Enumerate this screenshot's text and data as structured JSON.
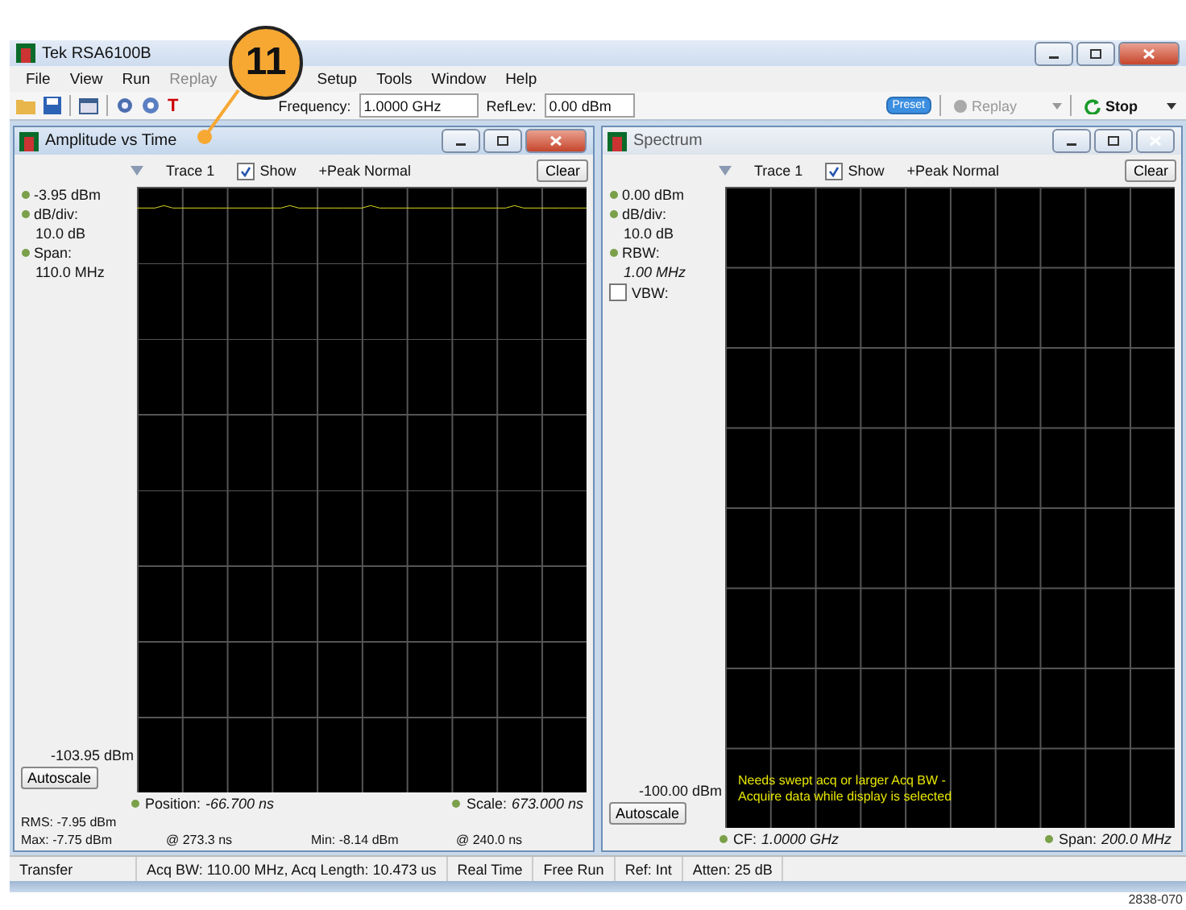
{
  "window": {
    "title": "Tek RSA6100B"
  },
  "callout": {
    "label": "11"
  },
  "menu": [
    {
      "label": "File",
      "disabled": false
    },
    {
      "label": "View",
      "disabled": false
    },
    {
      "label": "Run",
      "disabled": false
    },
    {
      "label": "Replay",
      "disabled": true
    },
    {
      "label": "Setup",
      "disabled": false
    },
    {
      "label": "Tools",
      "disabled": false
    },
    {
      "label": "Window",
      "disabled": false
    },
    {
      "label": "Help",
      "disabled": false
    }
  ],
  "toolbar": {
    "glyph": "T",
    "frequency": {
      "label": "Frequency:",
      "value": "1.0000 GHz"
    },
    "reflev": {
      "label": "RefLev:",
      "value": "0.00 dBm"
    },
    "preset": "Preset",
    "replay": {
      "label": "Replay",
      "disabled": true
    },
    "stop": "Stop"
  },
  "panes": [
    {
      "kind": "time",
      "title": "Amplitude vs Time",
      "active": true,
      "trace": "Trace 1",
      "show": {
        "label": "Show",
        "checked": true
      },
      "detection": "+Peak Normal",
      "clear": "Clear",
      "top": "-3.95 dBm",
      "params": [
        {
          "kind": "fixed",
          "label": "dB/div:",
          "value": "10.0 dB"
        },
        {
          "kind": "fixed",
          "label": "Span:",
          "value": "110.0 MHz"
        }
      ],
      "bottom": "-103.95 dBm",
      "autoscale": "Autoscale",
      "footer": [
        {
          "label": "Position:",
          "value": "-66.700 ns"
        },
        {
          "label": "Scale:",
          "value": "673.000 ns"
        }
      ],
      "stats": [
        {
          "label": "RMS:",
          "value": "-7.95 dBm"
        },
        {
          "label": "Max:",
          "value": "-7.75 dBm"
        },
        {
          "label": "@",
          "value": "273.3 ns"
        },
        {
          "label": "Min:",
          "value": "-8.14 dBm"
        },
        {
          "label": "@",
          "value": "240.0 ns"
        }
      ]
    },
    {
      "kind": "spectrum",
      "title": "Spectrum",
      "active": false,
      "trace": "Trace 1",
      "show": {
        "label": "Show",
        "checked": true
      },
      "detection": "+Peak Normal",
      "clear": "Clear",
      "top": "0.00 dBm",
      "params": [
        {
          "kind": "fixed",
          "label": "dB/div:",
          "value": "10.0 dB"
        },
        {
          "kind": "auto",
          "label": "RBW:",
          "value": "1.00 MHz"
        },
        {
          "kind": "checkbox",
          "label": "VBW:",
          "checked": false
        }
      ],
      "bottom": "-100.00 dBm",
      "autoscale": "Autoscale",
      "message": [
        "Needs swept acq or larger Acq BW -",
        "Acquire data while display is selected"
      ],
      "footer": [
        {
          "label": "CF:",
          "value": "1.0000 GHz"
        },
        {
          "label": "Span:",
          "value": "200.0 MHz"
        }
      ]
    }
  ],
  "status_bar": [
    "Transfer",
    "Acq BW: 110.00 MHz, Acq Length: 10.473 us",
    "Real Time",
    "Free Run",
    "Ref: Int",
    "Atten: 25 dB"
  ],
  "figure_id": "2838-070"
}
